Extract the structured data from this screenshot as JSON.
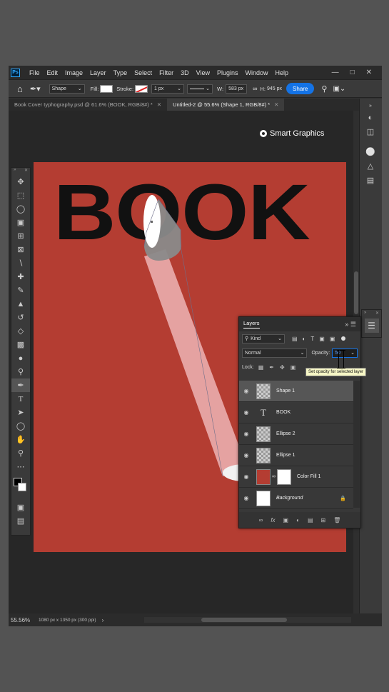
{
  "app": {
    "logo": "Ps",
    "menu": [
      "File",
      "Edit",
      "Image",
      "Layer",
      "Type",
      "Select",
      "Filter",
      "3D",
      "View",
      "Plugins",
      "Window",
      "Help"
    ]
  },
  "options": {
    "tool_mode": "Shape",
    "fill_label": "Fill:",
    "stroke_label": "Stroke:",
    "stroke_width": "1 px",
    "w_label": "W:",
    "w_value": "583 px",
    "h_label": "H:",
    "h_value": "945 px",
    "share_label": "Share"
  },
  "tabs": [
    {
      "label": "Book Cover typhography.psd @ 61.6% (BOOK, RGB/8#) *"
    },
    {
      "label": "Untitled-2 @ 55.6% (Shape 1, RGB/8#) *"
    }
  ],
  "canvas": {
    "title_text": "BOOK",
    "watermark": "Smart Graphics",
    "background_color": "#b43d32"
  },
  "status": {
    "zoom": "55.56%",
    "doc_info": "1080 px x 1350 px (300 ppi)"
  },
  "layers_panel": {
    "title": "Layers",
    "filter_kind": "Kind",
    "blend_mode": "Normal",
    "opacity_label": "Opacity:",
    "opacity_value": "50",
    "lock_label": "Lock:",
    "tooltip": "Set opacity for selected layer",
    "layers": [
      {
        "name": "Shape 1",
        "kind": "shape",
        "selected": true
      },
      {
        "name": "BOOK",
        "kind": "text",
        "selected": false
      },
      {
        "name": "Ellipse 2",
        "kind": "shape",
        "selected": false
      },
      {
        "name": "Ellipse 1",
        "kind": "shape",
        "selected": false
      },
      {
        "name": "Color Fill 1",
        "kind": "fill",
        "selected": false
      },
      {
        "name": "Background",
        "kind": "background",
        "selected": false,
        "locked": true
      }
    ]
  }
}
